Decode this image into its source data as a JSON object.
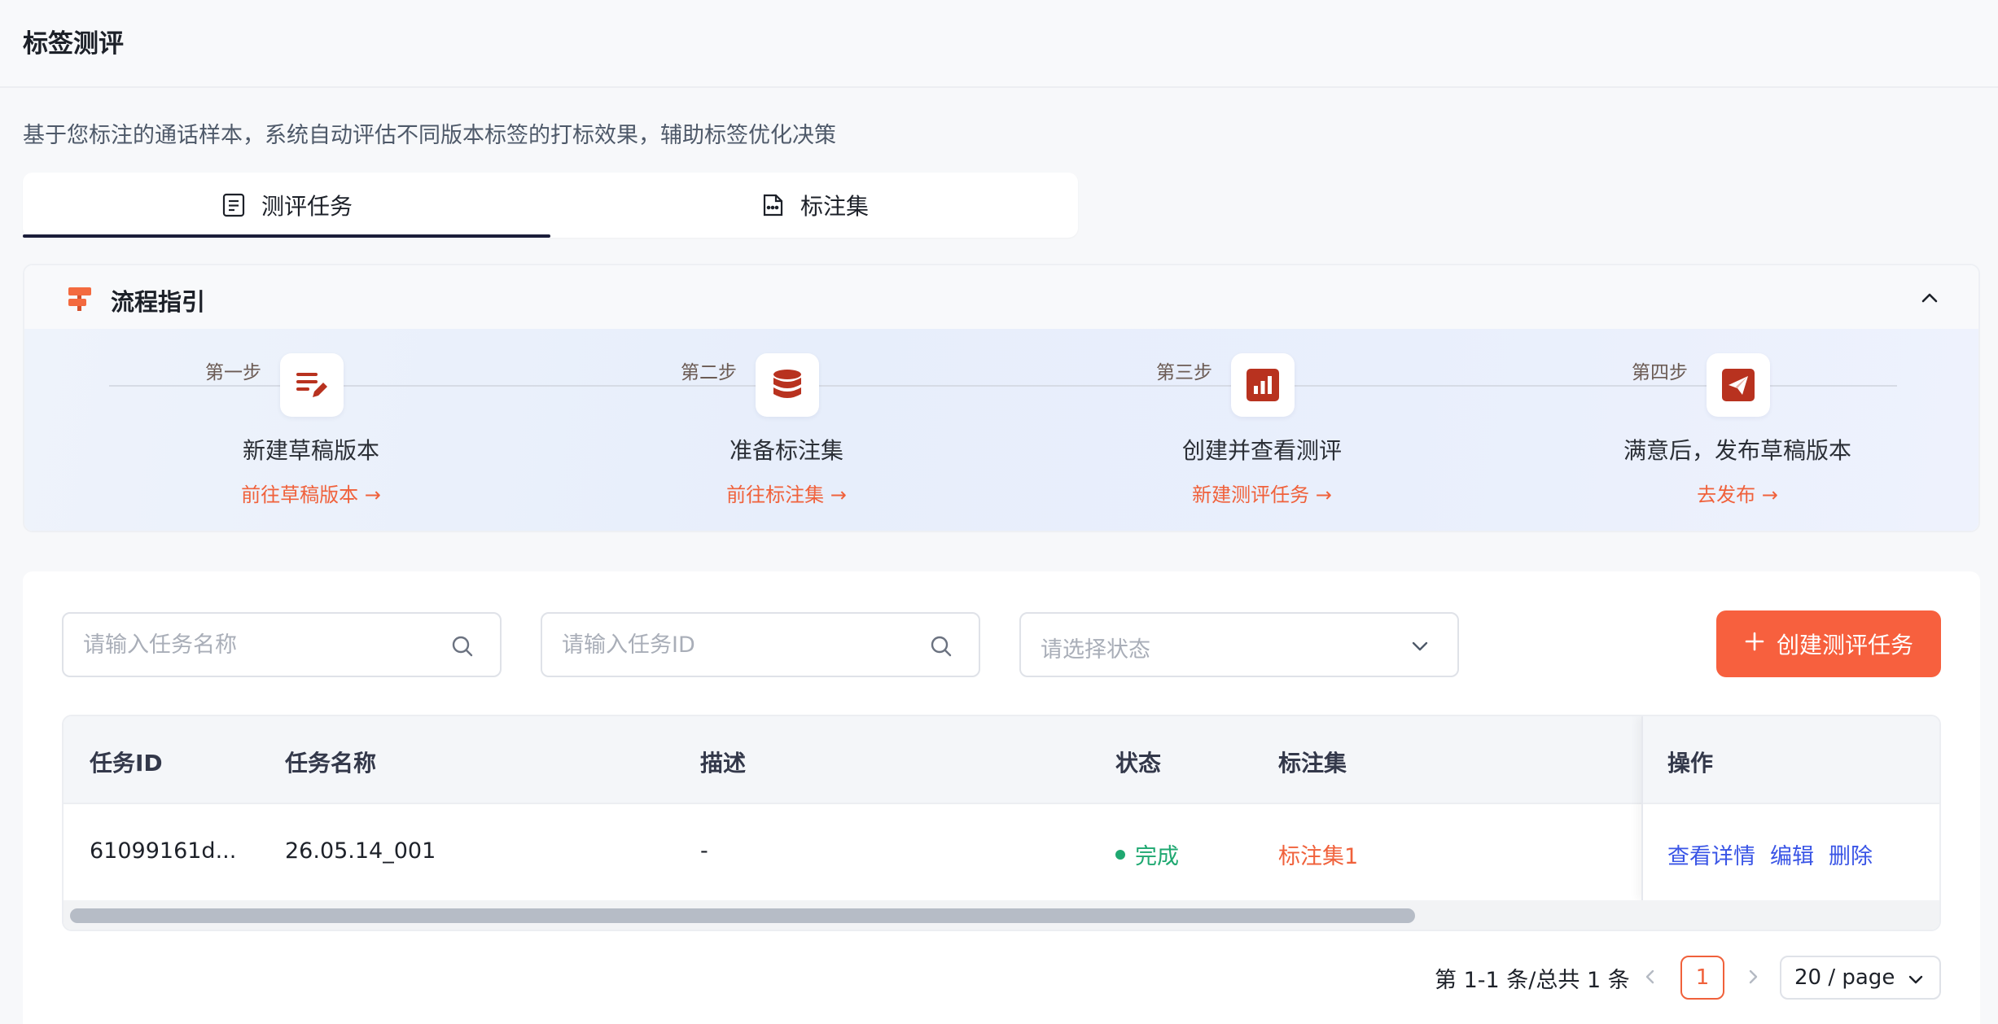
{
  "page": {
    "title": "标签测评",
    "description": "基于您标注的通话样本，系统自动评估不同版本标签的打标效果，辅助标签优化决策"
  },
  "tabs": [
    {
      "label": "测评任务",
      "icon": "document-icon",
      "active": true
    },
    {
      "label": "标注集",
      "icon": "file-dots-icon",
      "active": false
    }
  ],
  "guide": {
    "title": "流程指引",
    "icon": "signpost-icon",
    "steps": [
      {
        "label": "第一步",
        "name": "新建草稿版本",
        "link": "前往草稿版本 →",
        "icon": "edit-list-icon"
      },
      {
        "label": "第二步",
        "name": "准备标注集",
        "link": "前往标注集 →",
        "icon": "database-icon"
      },
      {
        "label": "第三步",
        "name": "创建并查看测评",
        "link": "新建测评任务 →",
        "icon": "bar-chart-icon"
      },
      {
        "label": "第四步",
        "name": "满意后，发布草稿版本",
        "link": "去发布 →",
        "icon": "send-icon"
      }
    ],
    "accent_color": "#b8321f"
  },
  "filters": {
    "task_name_placeholder": "请输入任务名称",
    "task_id_placeholder": "请输入任务ID",
    "status_placeholder": "请选择状态"
  },
  "create_button": {
    "label": "创建测评任务",
    "color": "#f7603e"
  },
  "table": {
    "columns": [
      "任务ID",
      "任务名称",
      "描述",
      "状态",
      "标注集",
      "操作"
    ],
    "rows": [
      {
        "task_id": "61099161d...",
        "task_name": "26.05.14_001",
        "description": "-",
        "status": "完成",
        "dataset": "标注集1",
        "actions": [
          "查看详情",
          "编辑",
          "删除"
        ]
      }
    ]
  },
  "pagination": {
    "info": "第 1-1 条/总共 1 条",
    "current_page": "1",
    "page_size": "20 / page"
  }
}
